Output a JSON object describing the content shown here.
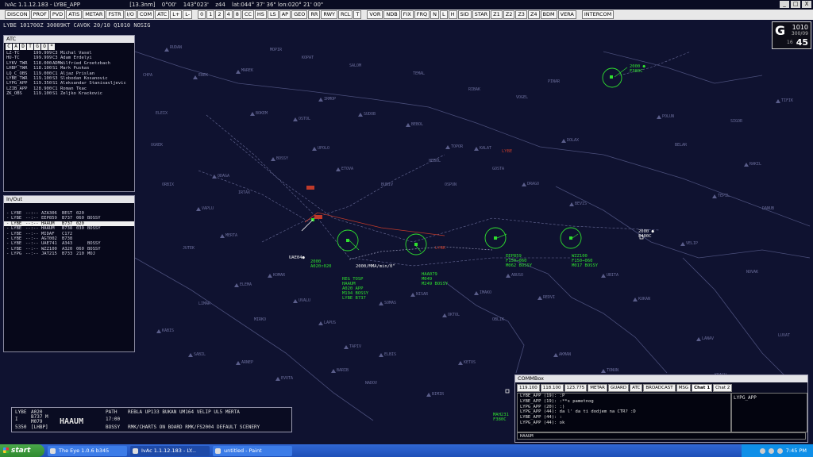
{
  "window": {
    "title": "IvAc 1.1.12.183 - LYBE_APP",
    "range": "[13.3nm]",
    "bearing": "0°00'",
    "radial": "143°023'",
    "zoom": "z44",
    "latlon": "lat:044° 37' 36\"  lon:020° 21' 00\"",
    "btn_min": "_",
    "btn_max": "□",
    "btn_close": "X"
  },
  "toolbar": {
    "left": [
      "DISCON",
      "PROF",
      "PVD",
      "ATIS",
      "METAR",
      "FSTR",
      "I/O",
      "COM",
      "ATC",
      "L+",
      "L-"
    ],
    "mid": [
      "0",
      "1",
      "2",
      "4",
      "8",
      "CC",
      "HS",
      "LS",
      "AP",
      "GEO",
      "RR",
      "RWY",
      "RCL",
      "T"
    ],
    "right": [
      "VOR",
      "NDB",
      "FIX",
      "FRQ",
      "N",
      "L",
      "H",
      "SID",
      "STAR",
      "Z1",
      "Z2",
      "Z3",
      "Z4",
      "BDM",
      "VERA"
    ],
    "intercom": "INTERCOM"
  },
  "metar": "LYBE 101700Z 30009KT CAVOK 20/10 Q1010 NOSIG",
  "clock": {
    "letter": "G",
    "qnh": "1010",
    "wind": "300/09",
    "hour": "45",
    "fl": "16"
  },
  "atc": {
    "title": "ATC",
    "filters": [
      "C",
      "A",
      "D",
      "T",
      "G",
      "O",
      "*"
    ],
    "rows": [
      {
        "callsign": "LZ-TC",
        "freq": "199.999",
        "rating": "C3",
        "name": "Michal Vasel"
      },
      {
        "callsign": "HU-TC",
        "freq": "199.999",
        "rating": "C3",
        "name": "Adam Erdelyi"
      },
      {
        "callsign": "LYKV_TWR",
        "freq": "118.000",
        "rating": "ADM",
        "name": "Wilfried Groetzbach"
      },
      {
        "callsign": "LHBP_TWR",
        "freq": "118.100",
        "rating": "S1",
        "name": "Mark Puskas"
      },
      {
        "callsign": "LQ_C_OBS",
        "freq": "119.000",
        "rating": "C1",
        "name": "Aljaz Prislan"
      },
      {
        "callsign": "LYBE_TWR",
        "freq": "119.100",
        "rating": "S3",
        "name": "Slobodan Kosanovic"
      },
      {
        "callsign": "LYPG_APP",
        "freq": "119.350",
        "rating": "S1",
        "name": "Aleksandar Stanisavljevic"
      },
      {
        "callsign": "LZIB_APP",
        "freq": "128.900",
        "rating": "C1",
        "name": "Roman Tkac"
      },
      {
        "callsign": "ZK_OBS",
        "freq": "119.100",
        "rating": "S1",
        "name": "Zeljko Krackovic"
      }
    ]
  },
  "inout": {
    "title": "In/Out",
    "rows": [
      {
        "apt": "LYBE",
        "sep": "--:--",
        "cs": "AZA306",
        "fix": "BEST",
        "fl": "020",
        "wp": ""
      },
      {
        "apt": "LYBE",
        "sep": "--:--",
        "cs": "EEP859",
        "fix": "B737",
        "fl": "060",
        "wp": "BOSSY"
      },
      {
        "apt": "LYBE",
        "sep": "--:--",
        "cs": "HAAUM",
        "fix": "B737",
        "fl": "020",
        "wp": "",
        "selected": true
      },
      {
        "apt": "LYBE",
        "sep": "--:--",
        "cs": "HAAUM",
        "fix": "B738",
        "fl": "030",
        "wp": "BOSSY"
      },
      {
        "apt": "LYBE",
        "sep": "--:--",
        "cs": "MIDAF",
        "fix": "C172",
        "fl": "",
        "wp": ""
      },
      {
        "apt": "LYBE",
        "sep": "--:--",
        "cs": "AGT002",
        "fix": "B738",
        "fl": "",
        "wp": ""
      },
      {
        "apt": "LYBE",
        "sep": "--:--",
        "cs": "UAE741",
        "fix": "A343",
        "fl": "",
        "wp": "BOSSY"
      },
      {
        "apt": "LYBE",
        "sep": "--:--",
        "cs": "WZZ100",
        "fix": "A320",
        "fl": "060",
        "wp": "BOSSY"
      },
      {
        "apt": "LYPG",
        "sep": "--:--",
        "cs": "JAT215",
        "fix": "B733",
        "fl": "210",
        "wp": "MOJ"
      }
    ]
  },
  "aircraft": [
    {
      "lines": "2000 ●\nF380C"
    },
    {
      "lines": "2000 ●\nF400C"
    },
    {
      "lines": "EEP859\nF150→060\nM062 BOSSY"
    },
    {
      "lines": "WZZ100\nF150→060\nM017 BOSSY"
    },
    {
      "lines": "HAA079\nM049\nM249 BOSSY"
    },
    {
      "lines": "REG TOSP\nHAAUM\nA020 APP\nM194 BOSSY\nLYBE B737"
    },
    {
      "lines": "2000\nA020↑020"
    },
    {
      "lines": "2000 ●\nF380C"
    },
    {
      "lines": "MAH231\nF380C"
    }
  ],
  "ac_white": "UAE04●",
  "alert_1": "2000/MMA/min/0\"",
  "airport_red": "LYBE",
  "fix_lybk": "LYBK",
  "fixes": [
    "RUDAN",
    "EBEK",
    "MAREK",
    "BOKEM",
    "OSTOL",
    "IRMOP",
    "SUDOB",
    "BEBOL",
    "TOPOR",
    "KALAT",
    "DRAGO",
    "BEVIS",
    "ODAGA",
    "MERTA",
    "VAPLU",
    "BOSSY",
    "UPOLO",
    "ETOVA",
    "ELEMA",
    "KOMAR",
    "UVALU",
    "LAPUS",
    "TAPIV",
    "SOMAS",
    "NISAR",
    "OKTOL",
    "IMAKO",
    "ABUSO",
    "REDVI",
    "UBITA",
    "KUKAN",
    "VELIP",
    "TEPIL",
    "RAKIL",
    "TIFIK",
    "POLUN",
    "DOLAX",
    "KABIS",
    "SABIL",
    "ARNEP",
    "EVOTA",
    "BARIB",
    "ELBIS",
    "BIMIR",
    "KETOS",
    "AKMAN",
    "TONUN",
    "LANAV",
    "CHPA",
    "ELEIX",
    "UGREK",
    "ORBIX",
    "MOPIR",
    "KOPAT",
    "SALOM",
    "TEMAL",
    "RIBAK",
    "VOGEL",
    "PINAR",
    "BELAR",
    "SIGOR",
    "DANUB",
    "NOVAK",
    "KRAGU",
    "LUVAT",
    "OSPUN",
    "BUNIV",
    "GOSTA",
    "HEBOL",
    "IRTAX",
    "JUTEK",
    "LIMAR",
    "MIRKO",
    "NADOV",
    "OBLIK"
  ],
  "strip": {
    "apt": "LYBE",
    "type": "B737 M",
    "squawk": "5350",
    "rfl": "A020",
    "ifr": "I",
    "m_level": "M079",
    "dest": "[LHBP]",
    "cs": "HAAUM",
    "lbl_path": "PATH",
    "time": "17:00",
    "route": "REBLA UP133 BUKAN UM164 VELIP UL5 MERTA",
    "remarks": "RMK/CHARTS ON BOARD RMK/FS2004 DEFAULT SCENERY",
    "exit": "BOSSY"
  },
  "comm": {
    "title": "COMMBox",
    "tabs": [
      "119.100",
      "118.100",
      "123.775",
      "METAR",
      "GUARD",
      "ATC",
      "BROADCAST",
      "MSG",
      "Chat 1",
      "Chat 2"
    ],
    "lines": [
      "LYBE_APP (19): :P",
      "LYBE_APP (19): :**s pametnog",
      "LYPG_APP (20): :)",
      "LYPG_APP (44): da l' da ti dodjem na CTR?  :D",
      "LYBE_APP (44): :",
      "LYPG_APP (44): ok"
    ],
    "user": "LYPG_APP",
    "input_label": "HAAUM"
  },
  "taskbar": {
    "start": "start",
    "items": [
      "The Eye 1.0.6 b345",
      "IvAc 1.1.12.183 - LY...",
      "untitled - Paint"
    ],
    "time": "7:45 PM"
  }
}
